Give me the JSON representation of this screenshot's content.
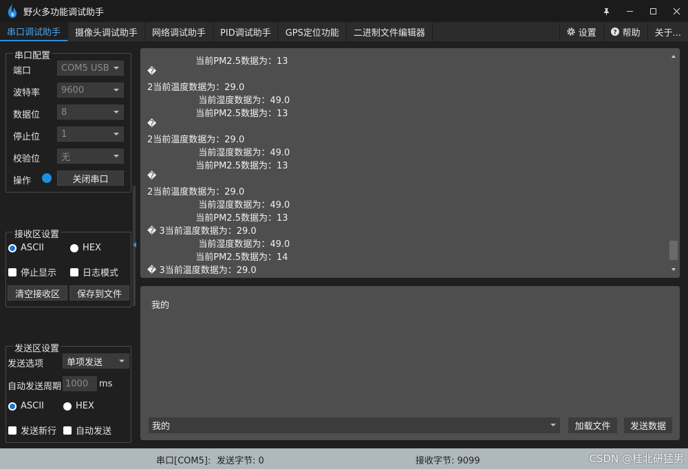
{
  "window": {
    "title": "野火多功能调试助手",
    "icons": [
      "flame-logo-icon",
      "pin-icon",
      "minimize-icon",
      "maximize-icon",
      "close-icon"
    ]
  },
  "tabs": [
    {
      "label": "串口调试助手",
      "active": true
    },
    {
      "label": "摄像头调试助手"
    },
    {
      "label": "网络调试助手"
    },
    {
      "label": "PID调试助手"
    },
    {
      "label": "GPS定位功能"
    },
    {
      "label": "二进制文件编辑器"
    }
  ],
  "tabs_right": {
    "settings": "设置",
    "help": "帮助",
    "about": "关于..."
  },
  "serial_config": {
    "title": "串口配置",
    "port_label": "端口",
    "port_value": "COM5 USB",
    "baud_label": "波特率",
    "baud_value": "9600",
    "databits_label": "数据位",
    "databits_value": "8",
    "stopbits_label": "停止位",
    "stopbits_value": "1",
    "parity_label": "校验位",
    "parity_value": "无",
    "operation_label": "操作",
    "close_button": "关闭串口"
  },
  "receive_settings": {
    "title": "接收区设置",
    "ascii": "ASCII",
    "hex": "HEX",
    "stop_display": "停止显示",
    "log_mode": "日志模式",
    "clear_button": "清空接收区",
    "save_button": "保存到文件"
  },
  "send_settings": {
    "title": "发送区设置",
    "option_label": "发送选项",
    "option_value": "单项发送",
    "period_label": "自动发送周期",
    "period_value": "1000",
    "period_unit": "ms",
    "ascii": "ASCII",
    "hex": "HEX",
    "newline": "发送新行",
    "auto_send": "自动发送"
  },
  "receive_lines": [
    "                 当前PM2.5数据为：13",
    "�",
    "2当前温度数据为：29.0",
    "                  当前湿度数据为：49.0",
    "                 当前PM2.5数据为：13",
    "�",
    "2当前温度数据为：29.0",
    "                  当前湿度数据为：49.0",
    "                 当前PM2.5数据为：13",
    "�",
    "2当前温度数据为：29.0",
    "                  当前湿度数据为：49.0",
    "                 当前PM2.5数据为：13",
    "� 3当前温度数据为：29.0",
    "                  当前湿度数据为：49.0",
    "                 当前PM2.5数据为：14",
    "� 3当前温度数据为：29.0"
  ],
  "send_area": {
    "text": "我的",
    "history_value": "我的",
    "load_file_button": "加载文件",
    "send_button": "发送数据"
  },
  "status": {
    "port": "串口[COM5]:",
    "sent": "发送字节: 0",
    "received": "接收字节: 9099",
    "watermark": "CSDN @桂北研猛男"
  }
}
